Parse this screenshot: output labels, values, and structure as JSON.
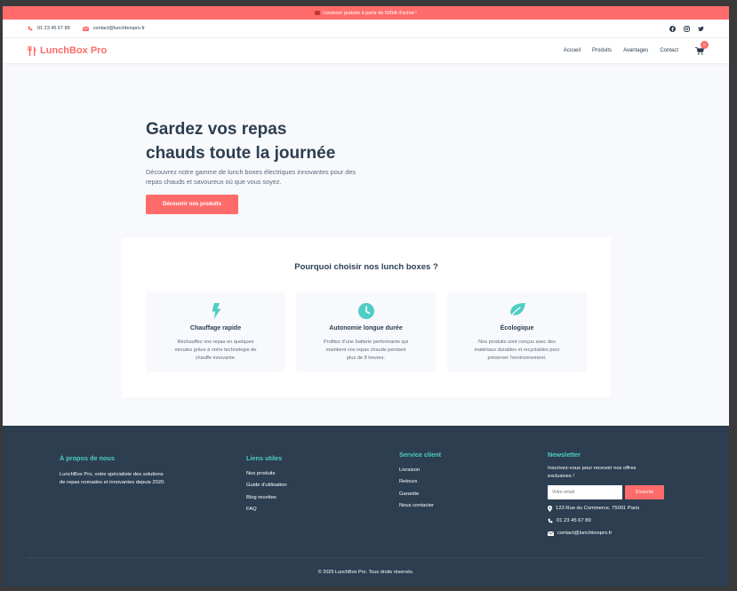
{
  "promo": {
    "text": "Livraison gratuite à partir de 500dt d'achat !"
  },
  "contact_bar": {
    "phone": "01 23 45 67 89",
    "email": "contact@lunchboxpro.fr"
  },
  "brand": {
    "name": "LunchBox Pro",
    "accent": "#ff6b6b",
    "teal": "#4ecdc4",
    "dark": "#2c3e50"
  },
  "nav": {
    "links": [
      "Accueil",
      "Produits",
      "Avantages",
      "Contact"
    ],
    "cart_count": "0"
  },
  "hero": {
    "title_line1": "Gardez vos repas",
    "title_line2": "chauds toute la journée",
    "subtitle": "Découvrez notre gamme de lunch boxes électriques innovantes pour des repas chauds et savoureux où que vous soyez.",
    "cta": "Découvrir nos produits"
  },
  "features": {
    "heading": "Pourquoi choisir nos lunch boxes ?",
    "items": [
      {
        "icon": "bolt-icon",
        "title": "Chauffage rapide",
        "text": "Réchauffez vos repas en quelques minutes grâce à notre technologie de chauffe innovante."
      },
      {
        "icon": "clock-icon",
        "title": "Autonomie longue durée",
        "text": "Profitez d'une batterie performante qui maintient vos repas chauds pendant plus de 8 heures."
      },
      {
        "icon": "leaf-icon",
        "title": "Écologique",
        "text": "Nos produits sont conçus avec des matériaux durables et recyclables pour préserver l'environnement."
      }
    ]
  },
  "footer": {
    "about": {
      "title": "À propos de nous",
      "text": "LunchBox Pro, votre spécialiste des solutions de repas nomades et innovantes depuis 2020."
    },
    "links": {
      "title": "Liens utiles",
      "items": [
        "Nos produits",
        "Guide d'utilisation",
        "Blog recettes",
        "FAQ"
      ]
    },
    "service": {
      "title": "Service client",
      "items": [
        "Livraison",
        "Retours",
        "Garantie",
        "Nous contacter"
      ]
    },
    "newsletter": {
      "title": "Newsletter",
      "text": "Inscrivez-vous pour recevoir nos offres exclusives !",
      "placeholder": "Votre email",
      "button": "S'inscrire",
      "address": "123 Rue du Commerce, 75001 Paris",
      "phone": "01 23 45 67 89",
      "email": "contact@lunchboxpro.fr"
    },
    "copyright": "© 2025 LunchBox Pro. Tous droits réservés."
  }
}
